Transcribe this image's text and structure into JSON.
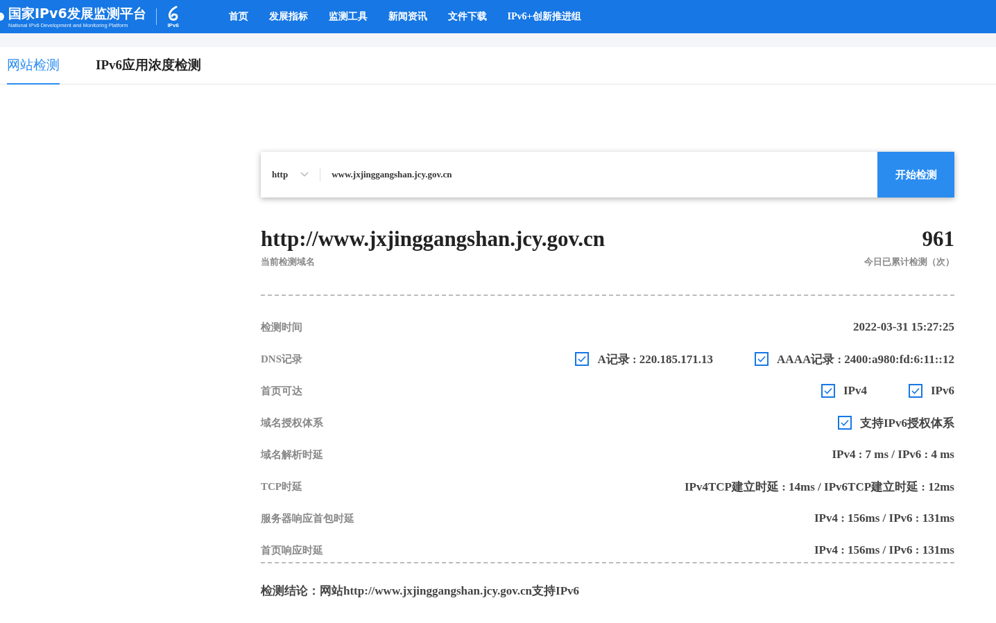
{
  "header": {
    "title": "国家IPv6发展监测平台",
    "subtitle": "National IPv6 Development and Monitoring Platform",
    "logo_text": "IPv6",
    "nav": [
      {
        "label": "首页"
      },
      {
        "label": "发展指标"
      },
      {
        "label": "监测工具"
      },
      {
        "label": "新闻资讯"
      },
      {
        "label": "文件下载"
      },
      {
        "label": "IPv6+创新推进组"
      }
    ]
  },
  "tabs": [
    {
      "label": "网站检测",
      "selected": true
    },
    {
      "label": "IPv6应用浓度检测",
      "selected": false
    }
  ],
  "search": {
    "protocol": "http",
    "value": "www.jxjinggangshan.jcy.gov.cn",
    "button": "开始检测"
  },
  "summary": {
    "domain": "http://www.jxjinggangshan.jcy.gov.cn",
    "domain_caption": "当前检测域名",
    "count": "961",
    "count_caption": "今日已累计检测（次）"
  },
  "rows": [
    {
      "label": "检测时间",
      "kind": "text",
      "value": "2022-03-31 15:27:25"
    },
    {
      "label": "DNS记录",
      "kind": "checks",
      "items": [
        {
          "text": "A记录 : 220.185.171.13",
          "checked": true
        },
        {
          "text": "AAAA记录 : 2400:a980:fd:6:11::12",
          "checked": true
        }
      ]
    },
    {
      "label": "首页可达",
      "kind": "checks",
      "items": [
        {
          "text": "IPv4",
          "checked": true
        },
        {
          "text": "IPv6",
          "checked": true
        }
      ]
    },
    {
      "label": "域名授权体系",
      "kind": "checks",
      "items": [
        {
          "text": "支持IPv6授权体系",
          "checked": true
        }
      ]
    },
    {
      "label": "域名解析时延",
      "kind": "text",
      "value": "IPv4 : 7 ms / IPv6 : 4 ms"
    },
    {
      "label": "TCP时延",
      "kind": "text",
      "value": "IPv4TCP建立时延 : 14ms / IPv6TCP建立时延 : 12ms"
    },
    {
      "label": "服务器响应首包时延",
      "kind": "text",
      "value": "IPv4 : 156ms / IPv6 : 131ms"
    },
    {
      "label": "首页响应时延",
      "kind": "text",
      "value": "IPv4 : 156ms / IPv6 : 131ms"
    }
  ],
  "conclusion": "检测结论：网站http://www.jxjinggangshan.jcy.gov.cn支持IPv6"
}
